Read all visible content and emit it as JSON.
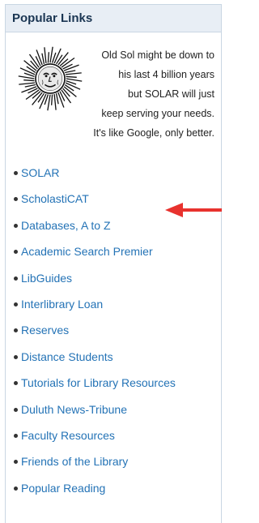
{
  "panel": {
    "title": "Popular Links"
  },
  "promo": {
    "image_icon": "sun-face-icon",
    "lines": [
      "Old Sol might be down to",
      "his last 4 billion years",
      "but SOLAR will just",
      "keep serving your needs.",
      "It's like Google, only better."
    ]
  },
  "links": [
    "SOLAR",
    "ScholastiCAT",
    "Databases, A to Z",
    "Academic Search Premier",
    "LibGuides",
    "Interlibrary Loan",
    "Reserves",
    "Distance Students",
    "Tutorials for Library Resources",
    "Duluth News-Tribune",
    "Faculty Resources",
    "Friends of the Library",
    "Popular Reading"
  ],
  "colors": {
    "link": "#2473b6",
    "header_bg": "#e8eef5",
    "arrow": "#e8322e"
  },
  "annotation": {
    "icon": "red-arrow-icon",
    "points_to": "Databases, A to Z"
  }
}
